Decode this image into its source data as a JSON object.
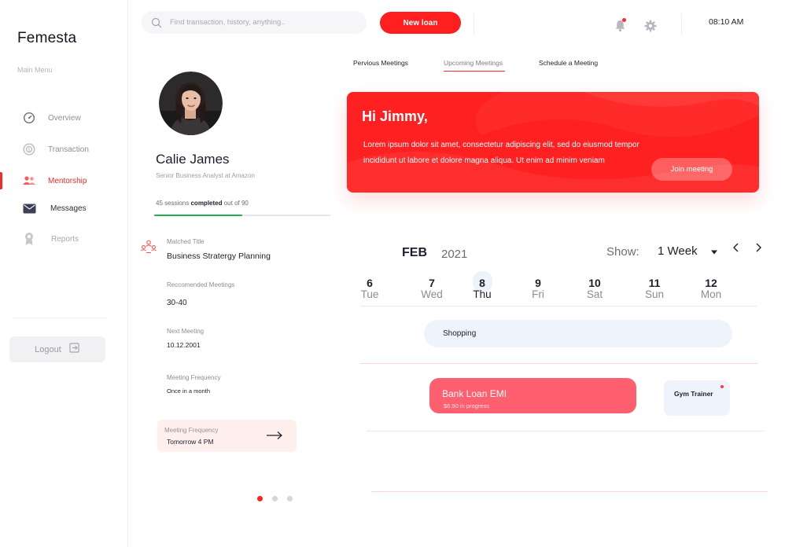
{
  "brand": "Femesta",
  "sidebar": {
    "caption": "Main Menu",
    "items": [
      {
        "label": "Overview",
        "icon": "speedometer-icon"
      },
      {
        "label": "Transaction",
        "icon": "coin-icon"
      },
      {
        "label": "Mentorship",
        "icon": "users-icon",
        "active": true
      },
      {
        "label": "Messages",
        "icon": "mail-icon"
      },
      {
        "label": "Reports",
        "icon": "award-icon"
      }
    ],
    "logout_label": "Logout"
  },
  "topbar": {
    "search_placeholder": "Find transaction, history, anything..",
    "new_loan_label": "New loan",
    "time": "08:10 AM"
  },
  "profile": {
    "name": "Calie James",
    "role": "Senior Business Analyst at Amazon",
    "sessions_prefix": "45 sessions",
    "sessions_bold": "completed",
    "sessions_suffix": "out of 90",
    "sessions_progress": 0.5,
    "matched_title_label": "Matched Title",
    "matched_title_value": "Business Stratergy Planning",
    "recommended_label": "Reccomended Meetings",
    "recommended_value": "30-40",
    "next_meeting_label": "Next Meeting",
    "next_meeting_value": "10.12.2001",
    "frequency_label": "Meeting Frequency",
    "frequency_value": "Once in a month",
    "card_label": "Meeting Frequency",
    "card_value": "Tomorrow 4 PM"
  },
  "carousel": {
    "count": 3,
    "active_index": 0
  },
  "tabs": [
    {
      "label": "Pervious Meetings"
    },
    {
      "label": "Upcoming Meetings",
      "active": true
    },
    {
      "label": "Schedule a Meeting"
    }
  ],
  "hero": {
    "greeting": "Hi Jimmy,",
    "line1": "Lorem ipsum dolor sit amet, consectetur adipiscing elit, sed do eiusmod tempor",
    "line2": "incididunt ut labore et dolore magna aliqua. Ut enim ad minim veniam",
    "button": "Join meeting"
  },
  "calendar": {
    "month": "FEB",
    "year": "2021",
    "show_label": "Show:",
    "show_value": "1 Week",
    "days": [
      {
        "num": "6",
        "wd": "Tue"
      },
      {
        "num": "7",
        "wd": "Wed"
      },
      {
        "num": "8",
        "wd": "Thu",
        "today": true
      },
      {
        "num": "9",
        "wd": "Fri"
      },
      {
        "num": "10",
        "wd": "Sat"
      },
      {
        "num": "11",
        "wd": "Sun"
      },
      {
        "num": "12",
        "wd": "Mon"
      }
    ],
    "events": {
      "shopping": "Shopping",
      "loan_title": "Bank Loan EMI",
      "loan_sub": "$6.90 in progress",
      "gym": "Gym Trainer"
    }
  },
  "colors": {
    "accent": "#ff2121",
    "progress": "#21b04b",
    "event_pink": "#ff5f6e",
    "event_light": "#eef3fc"
  }
}
